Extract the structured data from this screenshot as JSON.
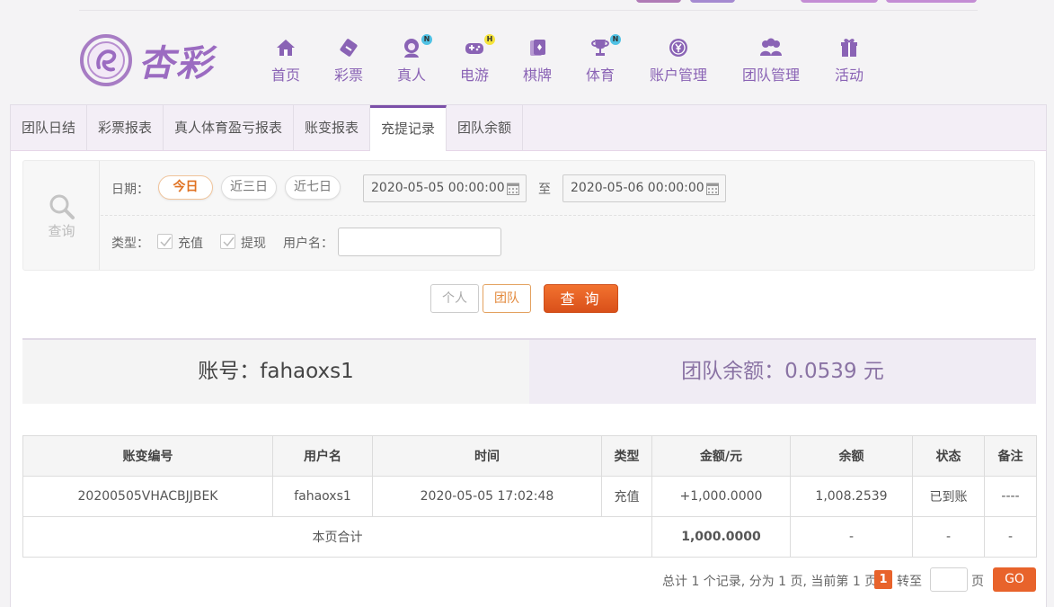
{
  "brand": {
    "name": "杏彩"
  },
  "nav": [
    {
      "label": "首页",
      "icon": "home-icon"
    },
    {
      "label": "彩票",
      "icon": "lottery-ticket-icon"
    },
    {
      "label": "真人",
      "icon": "live-dealer-icon",
      "badge": "N"
    },
    {
      "label": "电游",
      "icon": "gamepad-icon",
      "badge": "H"
    },
    {
      "label": "棋牌",
      "icon": "cards-icon"
    },
    {
      "label": "体育",
      "icon": "trophy-icon",
      "badge": "N"
    },
    {
      "label": "账户管理",
      "icon": "account-coin-icon"
    },
    {
      "label": "团队管理",
      "icon": "team-users-icon"
    },
    {
      "label": "活动",
      "icon": "gift-icon"
    }
  ],
  "tabs": [
    {
      "label": "团队日结"
    },
    {
      "label": "彩票报表"
    },
    {
      "label": "真人体育盈亏报表"
    },
    {
      "label": "账变报表"
    },
    {
      "label": "充提记录",
      "active": true
    },
    {
      "label": "团队余额"
    }
  ],
  "query": {
    "side_label": "查询",
    "date_label": "日期：",
    "ranges": [
      "今日",
      "近三日",
      "近七日"
    ],
    "active_range": "今日",
    "start": "2020-05-05 00:00:00",
    "to_label": "至",
    "end": "2020-05-06 00:00:00",
    "type_label": "类型：",
    "types": [
      "充值",
      "提现"
    ],
    "username_label": "用户名：",
    "username_value": "",
    "scope_personal": "个人",
    "scope_team": "团队",
    "submit": "查 询"
  },
  "summary": {
    "account": "账号：fahaoxs1",
    "team_balance": "团队余额：0.0539 元"
  },
  "table": {
    "headers": [
      "账变编号",
      "用户名",
      "时间",
      "类型",
      "金额/元",
      "余额",
      "状态",
      "备注"
    ],
    "rows": [
      [
        "20200505VHACBJJBEK",
        "fahaoxs1",
        "2020-05-05 17:02:48",
        "充值",
        "+1,000.0000",
        "1,008.2539",
        "已到账",
        "----"
      ]
    ],
    "total": {
      "label": "本页合计",
      "amount": "1,000.0000",
      "balance": "-",
      "status": "-",
      "remark": "-"
    }
  },
  "pager": {
    "info": "总计 1 个记录, 分为 1 页, 当前第 1 页",
    "current": "1",
    "goto_label": "转至",
    "page_label": "页",
    "go": "GO"
  },
  "colors": {
    "accent": "#8a63b5",
    "orange": "#e8632b",
    "green": "#4aa02c"
  }
}
